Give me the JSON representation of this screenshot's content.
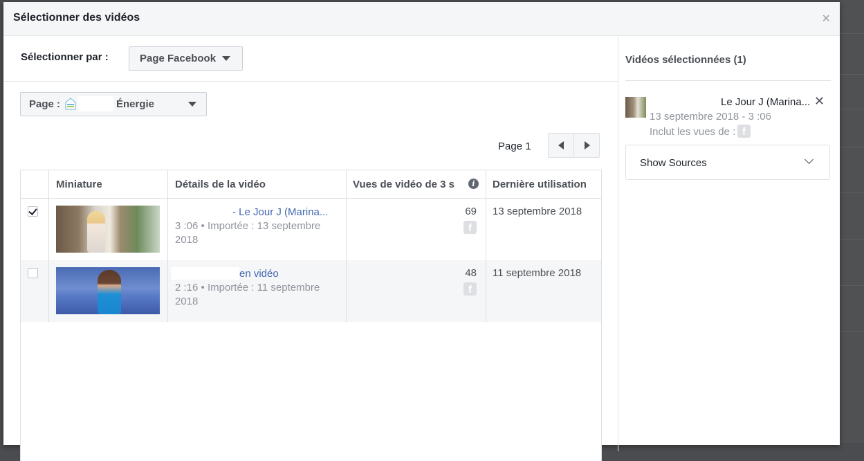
{
  "modal": {
    "title": "Sélectionner des vidéos",
    "close_label": "×"
  },
  "filters": {
    "select_by_label": "Sélectionner par :",
    "source_value": "Page Facebook",
    "page_label": "Page :",
    "page_name": "Énergie"
  },
  "pager": {
    "label": "Page 1"
  },
  "table": {
    "columns": {
      "thumbnail": "Miniature",
      "details": "Détails de la vidéo",
      "views": "Vues de vidéo de 3 s",
      "last_used": "Dernière utilisation"
    },
    "rows": [
      {
        "selected": true,
        "title": "- Le Jour J (Marina...",
        "meta": "3 :06 • Importée : 13 septembre 2018",
        "views": "69",
        "last_used": "13 septembre 2018"
      },
      {
        "selected": false,
        "title": "en vidéo",
        "meta": "2 :16 • Importée : 11 septembre 2018",
        "views": "48",
        "last_used": "11 septembre 2018"
      }
    ]
  },
  "selected_panel": {
    "title": "Vidéos sélectionnées (1)",
    "item": {
      "name": "Le Jour J (Marina...",
      "date_duration": "13 septembre 2018 - 3 :06",
      "includes_label": "Inclut les vues de :"
    },
    "show_sources_label": "Show Sources"
  },
  "icons": {
    "info": "info-icon",
    "facebook": "facebook-icon",
    "close": "close-icon",
    "chevron": "chevron-down-icon"
  },
  "colors": {
    "link": "#4267b2",
    "muted": "#90949c",
    "header_bg": "#f5f6f7"
  }
}
